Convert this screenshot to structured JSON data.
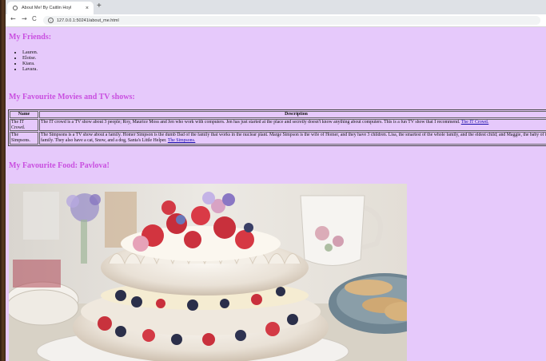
{
  "browser": {
    "tab_title": "About Me! By Caitlin Hoyl",
    "tab_close": "×",
    "new_tab": "+",
    "url": "127.0.0.1:50241/about_me.html",
    "back": "←",
    "forward": "→",
    "reload": "C",
    "info": "i"
  },
  "friends": {
    "heading": "My Friends:",
    "items": [
      "Lauren.",
      "Eloise.",
      "Kiara.",
      "Lavara."
    ]
  },
  "shows": {
    "heading": "My Favourite Movies and TV shows:",
    "headers": {
      "name": "Name",
      "description": "Description"
    },
    "rows": [
      {
        "name": "The IT Crowd.",
        "description": "The IT crowd is a TV show about 3 people; Roy, Maurice Moss and Jen who work with computers. Jen has just started at the place and secretly doesn't know anything about computers. This is a fun TV show that I recommend.",
        "link": "The IT Crowd."
      },
      {
        "name": "The Simpsons.",
        "description": "The Simpsons is a TV show about a family. Homer Simpson is the dumb Dad of the family that works in the nuclear plant. Marge Simpson is the wife of Homer, and they have 3 children. Lisa, the smartest of the whole family, and the eldest child; and Maggie, the baby of the family. They also have a cat, Snow, and a dog, Santa's Little Helper.",
        "link": "The Simpsons."
      }
    ]
  },
  "food": {
    "heading": "My Favourite Food: Pavlova!"
  },
  "colors": {
    "page_bg": "#e6c9fb",
    "heading": "#c94fe0",
    "link": "#1a0dab"
  }
}
